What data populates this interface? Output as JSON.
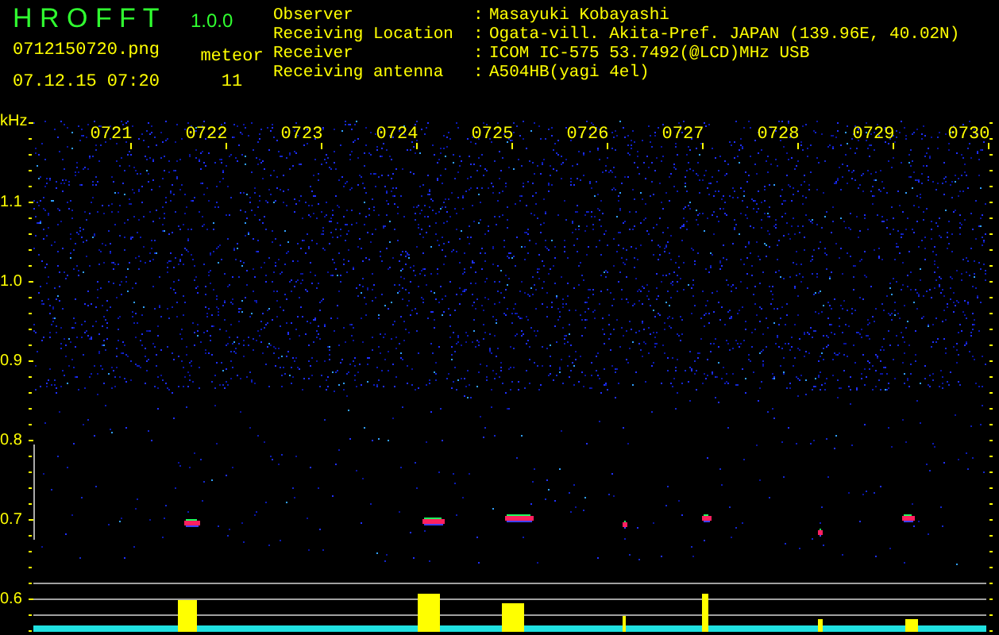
{
  "app": {
    "name": "H R O F F T",
    "version": "1.0.0"
  },
  "file_name": "0712150720.png",
  "timestamp": "07.12.15 07:20",
  "meteor": {
    "label": "meteor",
    "count": "11"
  },
  "info": [
    {
      "label": "Observer",
      "separator": ":",
      "value": "Masayuki Kobayashi"
    },
    {
      "label": "Receiving Location",
      "separator": ":",
      "value": "Ogata-vill. Akita-Pref. JAPAN (139.96E, 40.02N)"
    },
    {
      "label": "Receiver",
      "separator": ":",
      "value": "ICOM IC-575 53.7492(@LCD)MHz USB"
    },
    {
      "label": "Receiving antenna",
      "separator": ":",
      "value": "A504HB(yagi 4el)"
    }
  ],
  "frequency_axis": {
    "unit": "kHz",
    "labels": [
      "1.1",
      "1.0",
      "0.9",
      "0.8",
      "0.7",
      "0.6"
    ]
  },
  "time_axis": {
    "labels": [
      "0721",
      "0722",
      "0723",
      "0724",
      "0725",
      "0726",
      "0727",
      "0728",
      "0729",
      "0730"
    ]
  }
}
